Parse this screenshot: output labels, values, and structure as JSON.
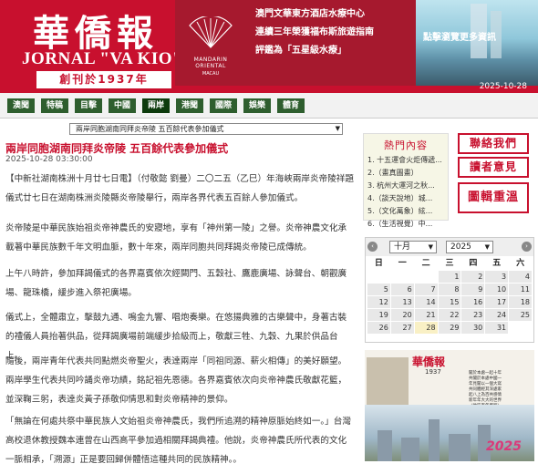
{
  "header": {
    "logo_cn": "華僑報",
    "logo_en": "JORNAL \"VA KIO\"",
    "since": "創刊於1937年",
    "date": "2025-10-28"
  },
  "ad": {
    "brand": "MANDARIN ORIENTAL",
    "brand_sub": "MACAU",
    "line1": "澳門文華東方酒店水療中心",
    "line2": "連續三年榮獲福布斯旅遊指南",
    "line3": "評鑑為「五星級水療」",
    "photo_text": "點擊瀏覽更多資訊"
  },
  "nav": {
    "items": [
      "澳聞",
      "特稿",
      "目擊",
      "中國",
      "兩岸",
      "港聞",
      "國際",
      "娛樂",
      "體育"
    ],
    "active_index": 4
  },
  "article": {
    "dropdown": "兩岸同胞湖南同拜炎帝陵 五百餘代表參加儀式",
    "title": "兩岸同胞湖南同拜炎帝陵 五百餘代表參加儀式",
    "date": "2025-10-28 03:30:00",
    "paragraphs": [
      "【中新社湖南株洲十月廿七日電】（付敬懿 劉曼）二〇二五（乙巳）年海峽兩岸炎帝陵祥題儀式廿七日在湖南株洲炎陵縣炎帝陵舉行，兩岸各界代表五百餘人參加儀式。",
      "炎帝陵是中華民族始祖炎帝神農氏的安寢地，享有「神州第一陵」之譽。炎帝神農文化承載著中華民族數千年文明血脈，數十年來，兩岸同胞共同拜謁炎帝陵已成傳統。",
      "上午八時許，參加拜謁儀式的各界嘉賓依次經闕門、五穀社、鷹鹿廣場、詠聲台、朝觀廣場、龍珠橋，緩步進入祭祀廣場。",
      "儀式上，全體肅立，擊鼓九通、鳴金九響、唱炮奏樂。在悠揚典雅的古樂聲中，身著古裝的禮儀人員抬著供品，從拜謁廣場前端緩步拾級而上，敬獻三牲、九穀、九果於供品台上。",
      "隨後，兩岸青年代表共同點燃炎帝聖火，表達兩岸「同祖同源、薪火相傳」的美好願望。兩岸學生代表共同吟誦炎帝功績，銘記祖先恩德。各界嘉賓依次向炎帝神農氏敬獻花籃，並深鞠三躬，表達炎黃子孫敬仰情思和對炎帝精神的景仰。",
      "「無論在何處共祭中華民族人文始祖炎帝神農氏，我們所追溯的精神原脈始終如一。」台灣高校退休教授魏本連曾在山西高平參加過相關拜謁典禮。他說，炎帝神農氏所代表的文化一脈相承，「溯源」正是要回歸併體悟這種共同的民族精神。。"
    ]
  },
  "sidebar": {
    "hot_title": "熱門內容",
    "hot_items": [
      "1. 十五運會火炬傳遞...",
      "2.（畫真圖畫）",
      "3. 杭州大運河之秋...",
      "4.（談天說地）城...",
      "5.（文化萬象）絃...",
      "6.（生活視覺）中..."
    ],
    "btn_contact": "聯絡我們",
    "btn_readers": "讀者意見",
    "btn_archive": "圖輯重溫"
  },
  "calendar": {
    "month": "十月",
    "year": "2025",
    "dow": [
      "日",
      "一",
      "二",
      "三",
      "四",
      "五",
      "六"
    ],
    "first_weekday": 3,
    "days_in_month": 31,
    "today": 28,
    "prev": "‹",
    "next": "›"
  },
  "promo": {
    "logo": "華僑報",
    "year": "1937",
    "lines": [
      "聞於本處一起十年",
      "共聞於本處中國一",
      "年見聞以一個大寫",
      "共同體經其深處家",
      "起八上為百共感情",
      "新年年大大的世界",
      "〈地區百年曆程〉"
    ],
    "badge": "2025"
  }
}
